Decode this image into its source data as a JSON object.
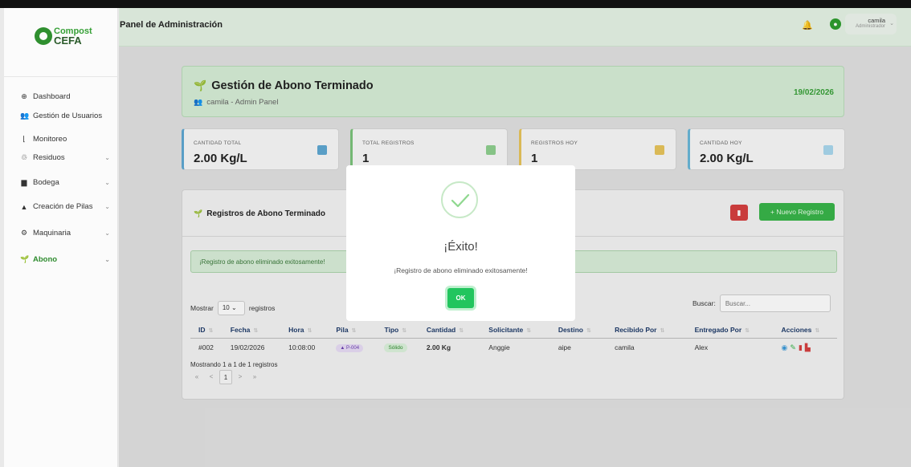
{
  "brand": {
    "logo_top": "Compost",
    "logo_bottom": "CEFA"
  },
  "header": {
    "title": "Panel de Administración",
    "user_name": "camila",
    "user_role": "Administrador",
    "avatar_initial": ""
  },
  "sidebar": {
    "items": [
      {
        "label": "Dashboard",
        "icon": "dashboard-icon",
        "has_children": false
      },
      {
        "label": "Gestión de Usuarios",
        "icon": "users-icon",
        "has_children": false
      },
      {
        "label": "Monitoreo",
        "icon": "chart-line-icon",
        "has_children": false
      },
      {
        "label": "Residuos",
        "icon": "recycle-icon",
        "has_children": true
      },
      {
        "label": "Bodega",
        "icon": "warehouse-icon",
        "has_children": true
      },
      {
        "label": "Creación de Pilas",
        "icon": "mountain-icon",
        "has_children": true
      },
      {
        "label": "Maquinaria",
        "icon": "cogs-icon",
        "has_children": true
      },
      {
        "label": "Abono",
        "icon": "seedling-icon",
        "has_children": true,
        "active": true
      }
    ]
  },
  "page": {
    "title": "Gestión de Abono Terminado",
    "subtitle": "camila - Admin Panel",
    "date": "19/02/2026"
  },
  "stats": [
    {
      "label": "CANTIDAD TOTAL",
      "value": "2.00 Kg/L",
      "color": "#5fa8d3"
    },
    {
      "label": "TOTAL REGISTROS",
      "value": "1",
      "color": "#7cc47c"
    },
    {
      "label": "REGISTROS HOY",
      "value": "1",
      "color": "#e8c55c"
    },
    {
      "label": "CANTIDAD HOY",
      "value": "2.00 Kg/L",
      "color": "#6ab7d8"
    }
  ],
  "registros": {
    "title": "Registros de Abono Terminado",
    "new_button": "+ Nuevo Registro",
    "alert": "¡Registro de abono eliminado exitosamente!",
    "show_prefix": "Mostrar",
    "show_value": "10",
    "show_suffix": "registros",
    "search_label": "Buscar:",
    "search_placeholder": "Buscar...",
    "columns": [
      "ID",
      "Fecha",
      "Hora",
      "Pila",
      "Tipo",
      "Cantidad",
      "Solicitante",
      "Destino",
      "Recibido Por",
      "Entregado Por",
      "Acciones"
    ],
    "rows": [
      {
        "id": "#002",
        "fecha": "19/02/2026",
        "hora": "10:08:00",
        "pila": "▲ P-004",
        "tipo": "Sólido",
        "cantidad": "2.00 Kg",
        "solicitante": "Anggie",
        "destino": "aipe",
        "recibido": "camila",
        "entregado": "Alex"
      }
    ],
    "info": "Mostrando 1 a 1 de 1 registros",
    "pager": {
      "first": "«",
      "prev": "<",
      "current": "1",
      "next": ">",
      "last": "»"
    }
  },
  "modal": {
    "title": "¡Éxito!",
    "message": "¡Registro de abono eliminado exitosamente!",
    "ok_label": "OK"
  },
  "colors": {
    "accent": "#39b54a",
    "header_bg": "#e6f4e6",
    "danger": "#d64040"
  }
}
